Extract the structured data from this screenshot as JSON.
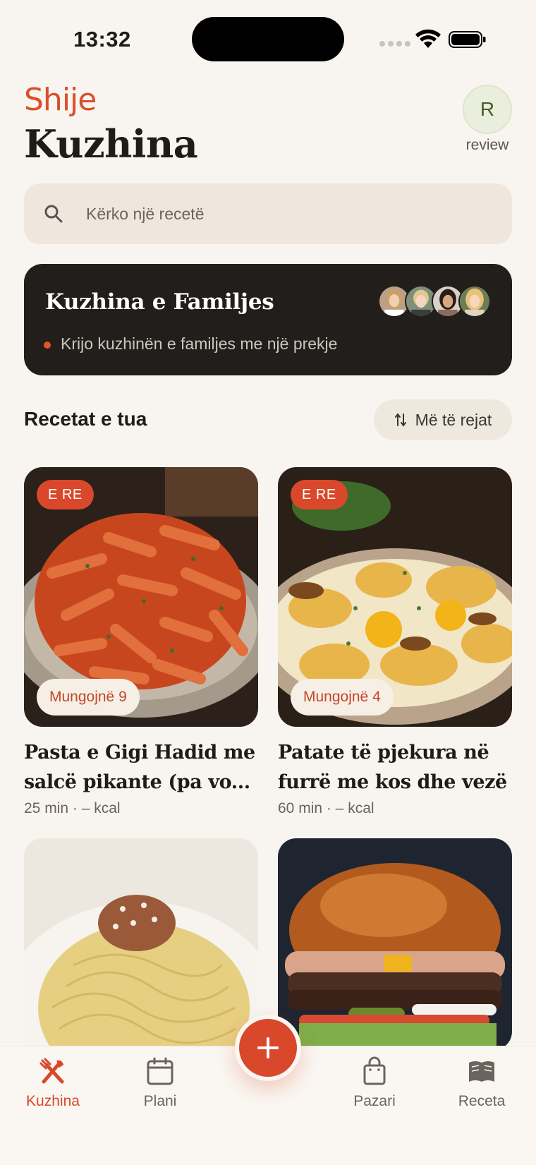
{
  "status_bar": {
    "time": "13:32"
  },
  "header": {
    "logo": "Shije",
    "title": "Kuzhina",
    "avatar_initial": "R",
    "avatar_label": "review"
  },
  "search": {
    "placeholder": "Kërko një recetë",
    "icon": "search-icon"
  },
  "family": {
    "title": "Kuzhina e Familjes",
    "subtitle": "Krijo kuzhinën e familjes me një prekje"
  },
  "recipes_section": {
    "title": "Recetat e tua",
    "sort_label": "Më të rejat"
  },
  "recipes": [
    {
      "badge": "E RE",
      "missing": "Mungojnë 9",
      "title": "Pasta e Gigi Hadid me salcë pikante (pa vo...",
      "meta": "25 min · – kcal"
    },
    {
      "badge": "E RE",
      "missing": "Mungojnë 4",
      "title": "Patate të pjekura në furrë me kos dhe vezë",
      "meta": "60 min · – kcal"
    },
    {
      "title": "",
      "meta": ""
    },
    {
      "title": "",
      "meta": ""
    }
  ],
  "nav": {
    "kuzhina": "Kuzhina",
    "plani": "Plani",
    "pazari": "Pazari",
    "receta": "Receta"
  },
  "colors": {
    "accent": "#d9482a",
    "background": "#f8f5f0",
    "dark_card": "#221e1b"
  }
}
